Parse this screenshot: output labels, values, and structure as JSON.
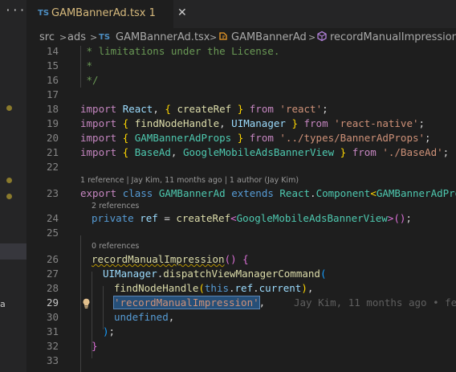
{
  "sidebar": {
    "more": "···",
    "letter": "a"
  },
  "tab": {
    "lang": "TS",
    "name": "GAMBannerAd.tsx",
    "badge": "1",
    "close": "✕"
  },
  "breadcrumb": {
    "p1": "src",
    "p2": "ads",
    "file_icon": "TS",
    "p3": "GAMBannerAd.tsx",
    "p4": "GAMBannerAd",
    "p5": "recordManualImpression"
  },
  "lines": {
    "n14": "14",
    "c14": " * limitations under the License.",
    "n15": "15",
    "c15": " *",
    "n16": "16",
    "c16": " */",
    "n17": "17",
    "n18": "18",
    "n19": "19",
    "n20": "20",
    "n21": "21",
    "n22": "22",
    "n23": "23",
    "n24": "24",
    "n25": "25",
    "n26": "26",
    "n27": "27",
    "n28": "28",
    "n29": "29",
    "n30": "30",
    "n31": "31",
    "n32": "32",
    "n33": "33"
  },
  "tokens": {
    "import": "import",
    "react": "React",
    "createRef": "createRef",
    "from": "from",
    "s_react": "'react'",
    "findNodeHandle": "findNodeHandle",
    "UIManager": "UIManager",
    "s_rn": "'react-native'",
    "GAMBannerAdProps": "GAMBannerAdProps",
    "s_types": "'../types/BannerAdProps'",
    "BaseAd": "BaseAd",
    "GoogleMobileAdsBannerView": "GoogleMobileAdsBannerView",
    "s_base": "'./BaseAd'",
    "export": "export",
    "class": "class",
    "GAMBannerAd": "GAMBannerAd",
    "extends": "extends",
    "Component": "Component",
    "private": "private",
    "ref": "ref",
    "recordManualImpression": "recordManualImpression",
    "dispatchViewManagerCommand": "dispatchViewManagerCommand",
    "this": "this",
    "current": "current",
    "s_rmi": "'recordManualImpression'",
    "undefined": "undefined"
  },
  "codelens": {
    "class_lens": "1 reference | Jay Kim, 11 months ago | 1 author (Jay Kim)",
    "ref_lens": "2 references",
    "method_lens": "0 references"
  },
  "blame": "Jay Kim, 11 months ago • fea",
  "colors": {
    "accent": "#264f78",
    "keyword": "#569cd6",
    "string": "#ce9178",
    "type": "#4ec9b0",
    "function": "#dcdcaa"
  }
}
